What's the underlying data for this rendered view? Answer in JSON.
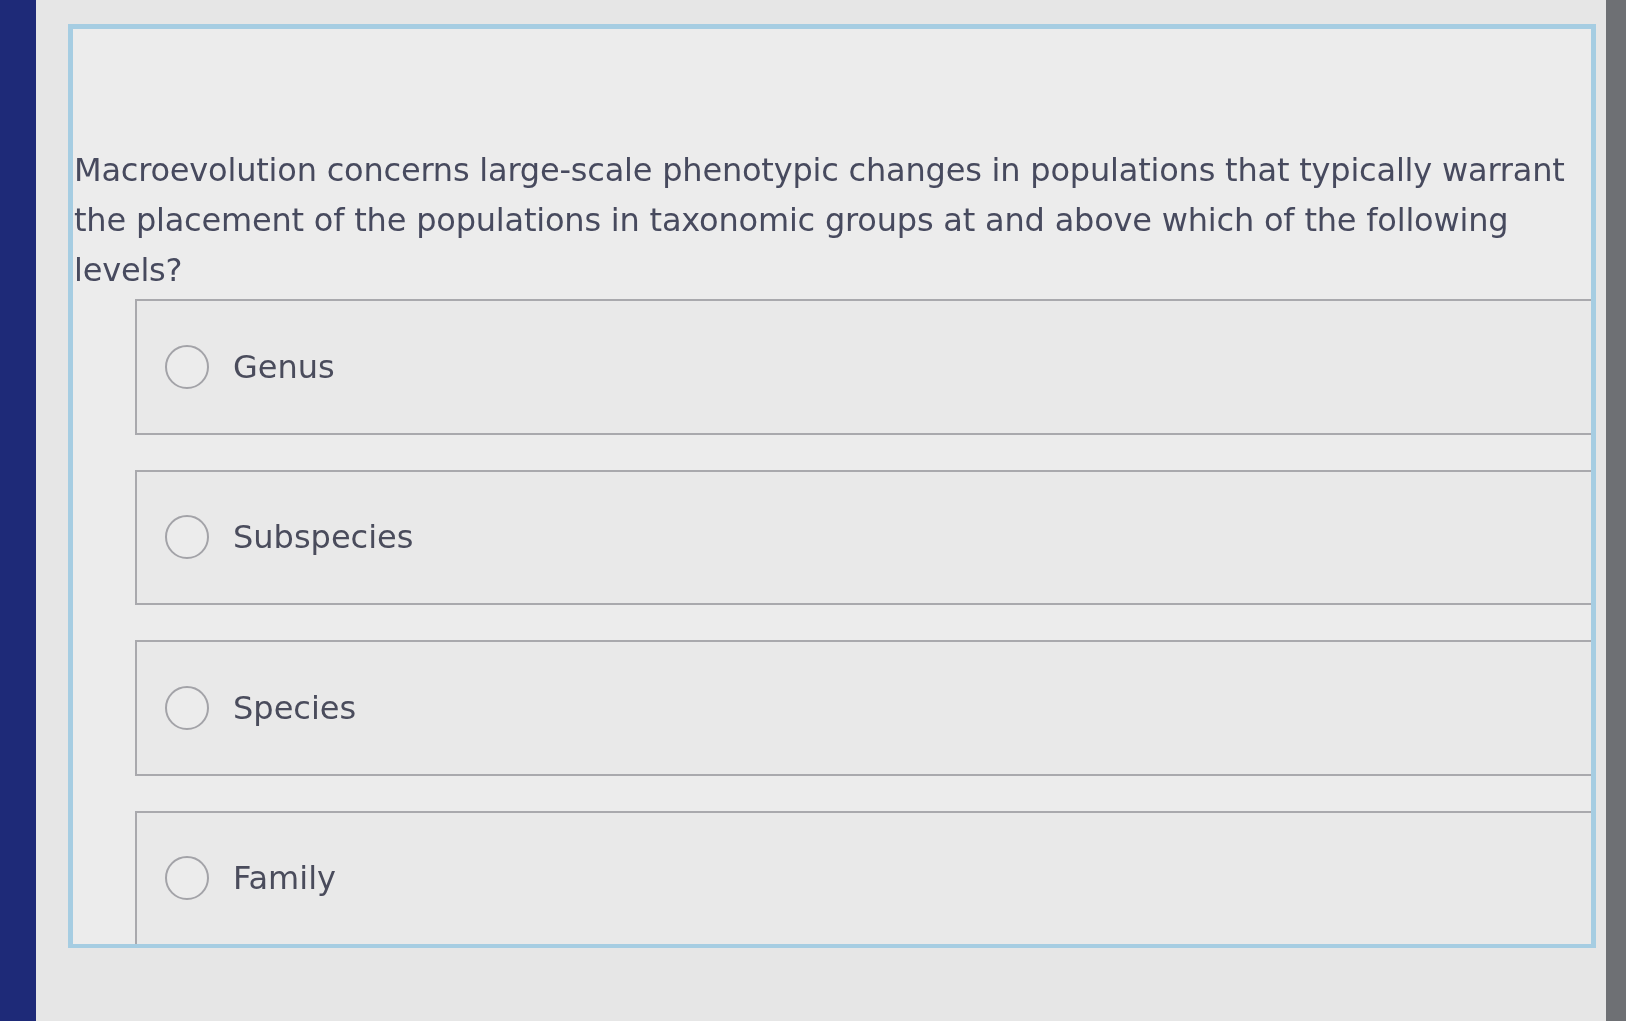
{
  "question": {
    "text": "Macroevolution concerns large-scale phenotypic changes in populations that typically warrant the placement of the populations in taxonomic groups at and above which of the following levels?"
  },
  "options": [
    {
      "label": "Genus",
      "selected": false
    },
    {
      "label": "Subspecies",
      "selected": false
    },
    {
      "label": "Species",
      "selected": false
    },
    {
      "label": "Family",
      "selected": false
    }
  ]
}
